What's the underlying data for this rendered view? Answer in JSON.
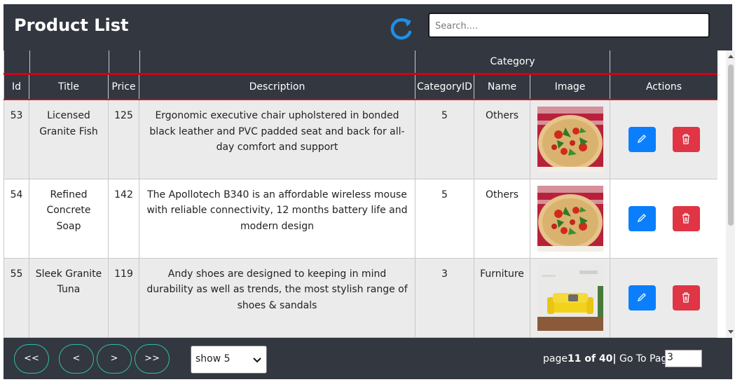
{
  "header": {
    "title": "Product List",
    "refresh_icon": "refresh-icon",
    "search": {
      "placeholder": "Search....",
      "value": ""
    }
  },
  "table": {
    "group_header": {
      "category_label": "Category"
    },
    "columns": [
      "Id",
      "Title",
      "Price",
      "Description",
      "CategoryID",
      "Name",
      "Image",
      "Actions"
    ],
    "rows": [
      {
        "id": "53",
        "title": "Licensed Granite Fish",
        "price": "125",
        "description": "Ergonomic executive chair upholstered in bonded black leather and PVC padded seat and back for all-day comfort and support",
        "category_id": "5",
        "category_name": "Others",
        "image": "pizza"
      },
      {
        "id": "54",
        "title": "Refined Concrete Soap",
        "price": "142",
        "description": "The Apollotech B340 is an affordable wireless mouse with reliable connectivity, 12 months battery life and modern design",
        "category_id": "5",
        "category_name": "Others",
        "image": "pizza"
      },
      {
        "id": "55",
        "title": "Sleek Granite Tuna",
        "price": "119",
        "description": "Andy shoes are designed to keeping in mind durability as well as trends, the most stylish range of shoes & sandals",
        "category_id": "3",
        "category_name": "Furniture",
        "image": "yellow-sofa"
      }
    ],
    "actions": {
      "edit_icon": "pencil-icon",
      "delete_icon": "trash-icon"
    }
  },
  "pagination": {
    "first_label": "<<",
    "prev_label": "<",
    "next_label": ">",
    "last_label": ">>",
    "page_size_selected": "show 5",
    "page_prefix": "page",
    "current_page_text": "11 of 40",
    "separator": "|",
    "goto_label": " Go To Page",
    "goto_value": "3"
  },
  "colors": {
    "header_bg": "#333740",
    "accent_red": "#d0021b",
    "edit_blue": "#0b7ffb",
    "delete_red": "#df3545",
    "pager_border": "#2fbfa0",
    "refresh_blue": "#1e8fe6"
  }
}
